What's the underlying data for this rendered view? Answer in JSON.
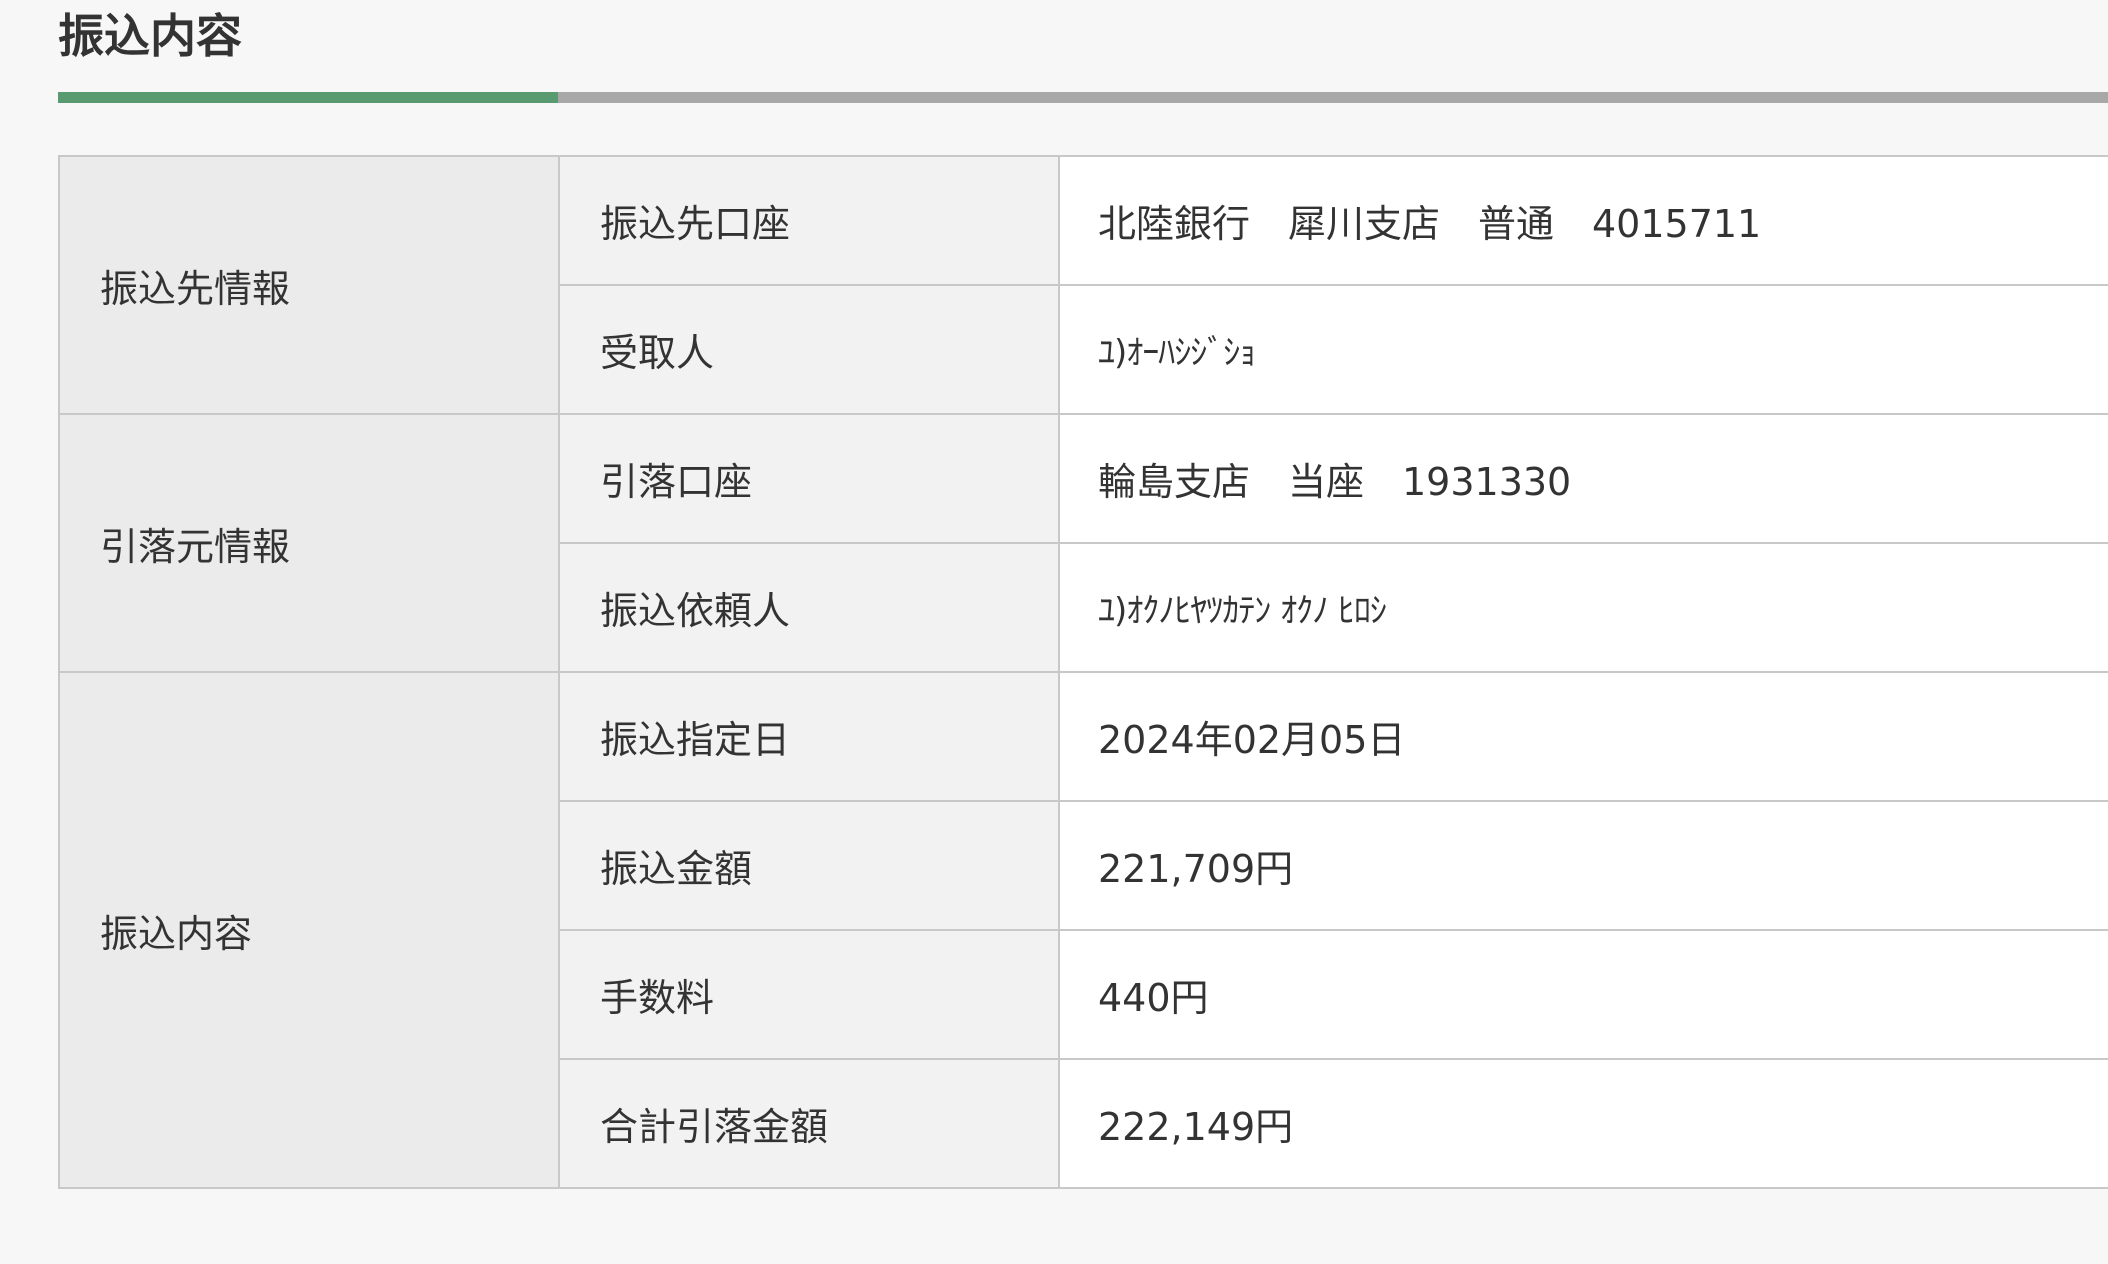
{
  "section": {
    "title": "振込内容"
  },
  "colors": {
    "accent": "#5a9a70",
    "rule": "#a8a8a8",
    "group_bg": "#ebebeb",
    "label_bg": "#f2f2f2",
    "value_bg": "#ffffff"
  },
  "groups": {
    "payee": {
      "label": "振込先情報",
      "rows": [
        {
          "label": "振込先口座",
          "value": "北陸銀行　犀川支店　普通　4015711"
        },
        {
          "label": "受取人",
          "value": "ﾕ)ｵｰﾊｼｼﾞｼｮ"
        }
      ]
    },
    "debit": {
      "label": "引落元情報",
      "rows": [
        {
          "label": "引落口座",
          "value": "輪島支店　当座　1931330"
        },
        {
          "label": "振込依頼人",
          "value": "ﾕ)ｵｸﾉﾋﾔﾂｶﾃﾝ ｵｸﾉ ﾋﾛｼ"
        }
      ]
    },
    "transfer": {
      "label": "振込内容",
      "rows": [
        {
          "label": "振込指定日",
          "value": "2024年02月05日"
        },
        {
          "label": "振込金額",
          "value": "221,709円"
        },
        {
          "label": "手数料",
          "value": "440円"
        },
        {
          "label": "合計引落金額",
          "value": "222,149円"
        }
      ]
    }
  }
}
